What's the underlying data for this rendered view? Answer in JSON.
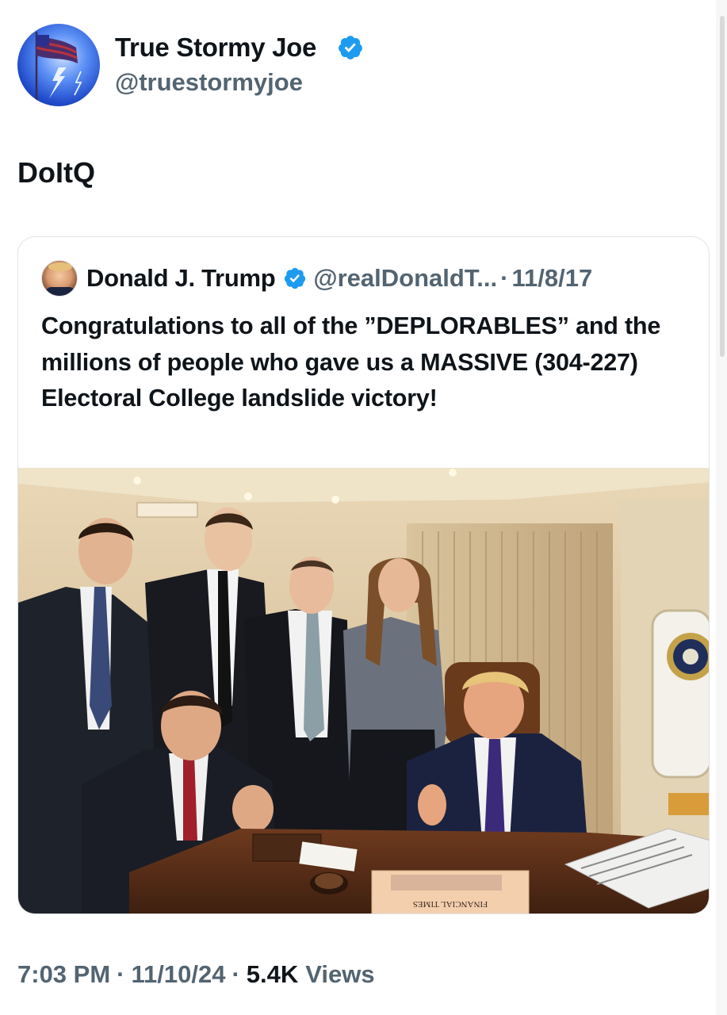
{
  "author": {
    "name": "True Stormy Joe",
    "handle": "@truestormyjoe",
    "avatar_icon": "flag-lightning-avatar",
    "verified_icon": "verified-badge-icon"
  },
  "tweet": {
    "text": "DoItQ"
  },
  "quoted_tweet": {
    "name": "Donald J. Trump",
    "handle": "@realDonaldT...",
    "separator": "·",
    "date": "11/8/17",
    "text": "Congratulations to all of the ”DEPLORABLES” and the millions of people who gave us a MASSIVE (304-227) Electoral College landslide victory!",
    "image_newspaper_masthead": "FINANCIAL TIMES"
  },
  "meta": {
    "time": "7:03 PM",
    "separator": "·",
    "date": "11/10/24",
    "views_count": "5.4K",
    "views_label": "Views"
  },
  "colors": {
    "text_primary": "#0f1419",
    "text_secondary": "#536471",
    "verified_blue": "#1d9bf0",
    "card_border": "#dfe3e6"
  }
}
